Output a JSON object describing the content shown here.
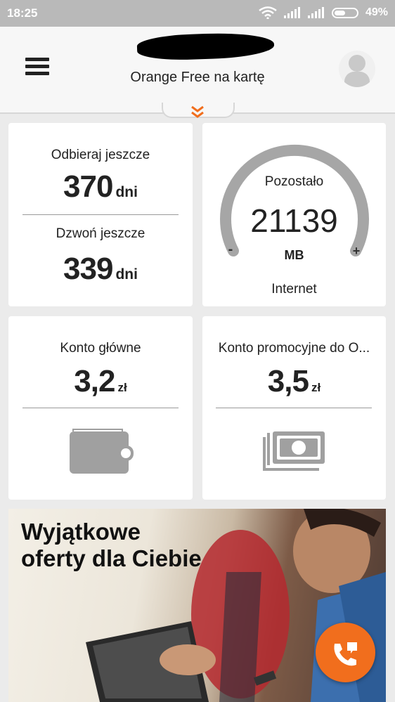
{
  "status_bar": {
    "time": "18:25",
    "battery": "49%"
  },
  "header": {
    "title": "Orange Free na kartę"
  },
  "card_validity": {
    "receive_label": "Odbieraj jeszcze",
    "receive_value": "370",
    "receive_unit": "dni",
    "call_label": "Dzwoń jeszcze",
    "call_value": "339",
    "call_unit": "dni"
  },
  "card_internet": {
    "label": "Pozostało",
    "value": "21139",
    "unit": "MB",
    "minus": "-",
    "plus": "+",
    "caption": "Internet"
  },
  "card_main_account": {
    "label": "Konto główne",
    "value": "3,2",
    "unit": "zł"
  },
  "card_promo_account": {
    "label": "Konto promocyjne do O...",
    "value": "3,5",
    "unit": "zł"
  },
  "banner": {
    "line1": "Wyjątkowe",
    "line2": "oferty dla Ciebie"
  },
  "colors": {
    "accent": "#f16e1d",
    "gauge": "#a6a6a6",
    "icon": "#a0a0a0"
  },
  "icons": [
    "menu-icon",
    "avatar-icon",
    "chevron-down-icon",
    "wallet-icon",
    "cash-icon",
    "phone-icon",
    "wifi-icon",
    "signal-icon",
    "battery-icon"
  ]
}
